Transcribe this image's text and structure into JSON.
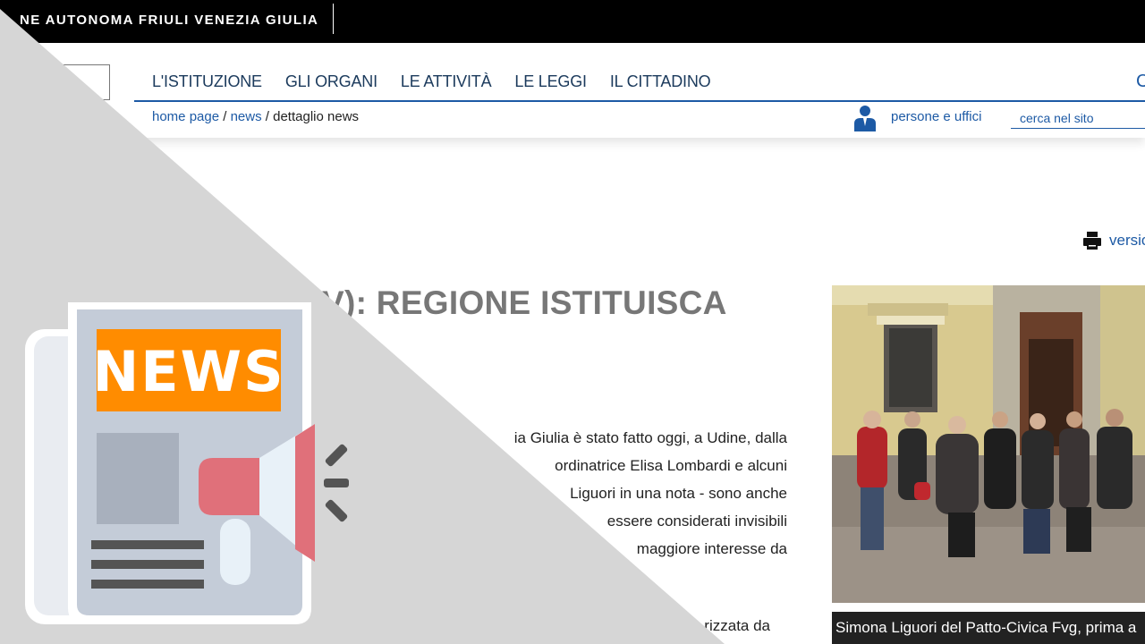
{
  "header": {
    "title": "NE AUTONOMA FRIULI VENEZIA GIULIA"
  },
  "nav": {
    "items": [
      {
        "label": "L'ISTITUZIONE"
      },
      {
        "label": "GLI ORGANI"
      },
      {
        "label": "LE ATTIVITÀ"
      },
      {
        "label": "LE LEGGI"
      },
      {
        "label": "IL CITTADINO"
      }
    ],
    "right_partial": "C"
  },
  "breadcrumb": {
    "home": "home page",
    "sep1": " / ",
    "news": "news",
    "sep2": " / ",
    "current": "dettaglio news"
  },
  "utility": {
    "persone_label": "persone e uffici",
    "search_placeholder": "cerca nel sito"
  },
  "article": {
    "print_label": "versio",
    "headline": "V): REGIONE ISTITUISCA",
    "body_lines": [
      "ia Giulia è stato fatto oggi, a Udine, dalla",
      "ordinatrice Elisa Lombardi e alcuni",
      "Liguori in una nota - sono anche",
      "essere considerati invisibili",
      "maggiore interesse da"
    ],
    "body_bottom": "rizzata da",
    "photo_caption": "Simona Liguori del Patto-Civica Fvg, prima a"
  },
  "overlay": {
    "badge_text": "NEWS",
    "colors": {
      "gray_triangle": "#d6d6d6",
      "badge_orange": "#ff8c00",
      "paper_blue": "#c4ccd8",
      "megaphone_pink": "#e0707a",
      "dark_lines": "#545454"
    }
  },
  "colors": {
    "link_blue": "#1d5aa5",
    "nav_text": "#1b3a5c",
    "topbar": "#000000"
  }
}
